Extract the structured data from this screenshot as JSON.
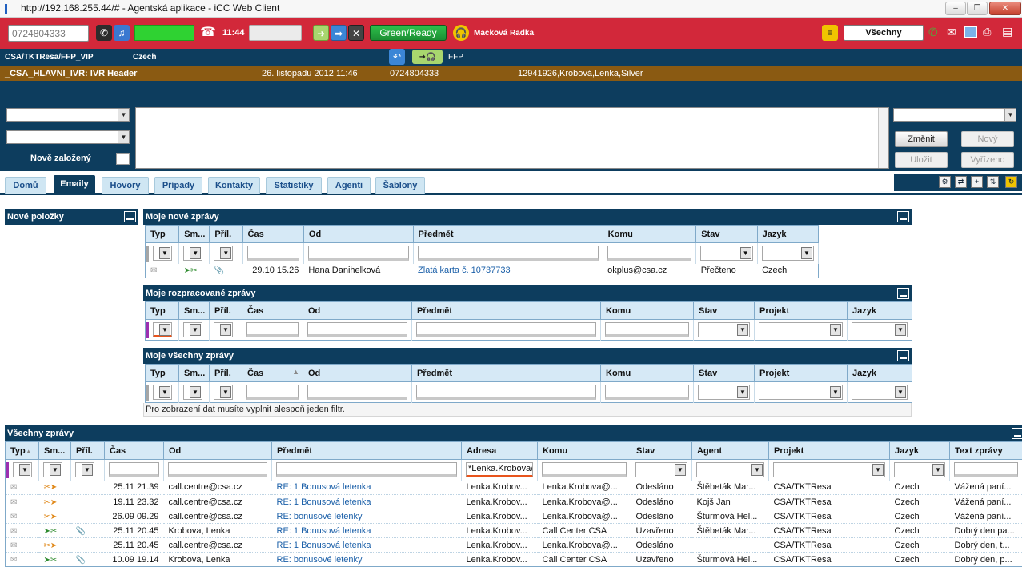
{
  "window": {
    "title": "http://192.168.255.44/# - Agentská aplikace - iCC Web Client"
  },
  "toolbar": {
    "phone_number": "0724804333",
    "call_time": "11:44",
    "status_label": "Green/Ready",
    "agent_name": "Macková Radka",
    "queue_select": "Všechny"
  },
  "info": {
    "campaign": "CSA/TKTResa/FFP_VIP",
    "language": "Czech",
    "ffp": "FFP"
  },
  "call": {
    "ivr": "_CSA_HLAVNI_IVR: IVR Header",
    "datetime": "26. listopadu 2012 11:46",
    "number": "0724804333",
    "customer": "12941926,Krobová,Lenka,Silver"
  },
  "form": {
    "new_created_label": "Nově založený",
    "buttons": {
      "change": "Změnit",
      "new": "Nový",
      "save": "Uložit",
      "done": "Vyřízeno"
    }
  },
  "tabs": [
    "Domů",
    "Emaily",
    "Hovory",
    "Případy",
    "Kontakty",
    "Statistiky",
    "Agenti",
    "Šablony"
  ],
  "panels": {
    "new_items": "Nové položky",
    "my_new": "Moje nové zprávy",
    "my_wip": "Moje rozpracované zprávy",
    "my_all": "Moje všechny zprávy",
    "all": "Všechny zprávy"
  },
  "columns": {
    "typ": "Typ",
    "sm": "Sm...",
    "pril": "Příl.",
    "cas": "Čas",
    "od": "Od",
    "predmet": "Předmět",
    "komu": "Komu",
    "stav": "Stav",
    "jazyk": "Jazyk",
    "projekt": "Projekt",
    "adresa": "Adresa",
    "agent": "Agent",
    "text": "Text zprávy"
  },
  "my_new_rows": [
    {
      "cas": "29.10 15.26",
      "od": "Hana Danihelková",
      "predmet": "Zlatá karta č. 10737733",
      "komu": "okplus@csa.cz",
      "stav": "Přečteno",
      "jazyk": "Czech"
    }
  ],
  "filter_note": "Pro zobrazení dat musíte vyplnit alespoň jeden filtr.",
  "address_filter": "*Lenka.Krobova@",
  "all_rows": [
    {
      "cas": "25.11 21.39",
      "od": "call.centre@csa.cz",
      "predmet": "RE: 1 Bonusová letenka",
      "adresa": "Lenka.Krobov...",
      "komu": "Lenka.Krobova@...",
      "stav": "Odesláno",
      "agent": "Štěbeták Mar...",
      "projekt": "CSA/TKTResa",
      "jazyk": "Czech",
      "text": "Vážená paní..."
    },
    {
      "cas": "19.11 23.32",
      "od": "call.centre@csa.cz",
      "predmet": "RE: 1 Bonusová letenka",
      "adresa": "Lenka.Krobov...",
      "komu": "Lenka.Krobova@...",
      "stav": "Odesláno",
      "agent": "Kojš Jan",
      "projekt": "CSA/TKTResa",
      "jazyk": "Czech",
      "text": "Vážená paní..."
    },
    {
      "cas": "26.09 09.29",
      "od": "call.centre@csa.cz",
      "predmet": "RE: bonusové letenky",
      "adresa": "Lenka.Krobov...",
      "komu": "Lenka.Krobova@...",
      "stav": "Odesláno",
      "agent": "Šturmová Hel...",
      "projekt": "CSA/TKTResa",
      "jazyk": "Czech",
      "text": "Vážená paní..."
    },
    {
      "cas": "25.11 20.45",
      "od": "Krobova, Lenka",
      "predmet": "RE: 1 Bonusová letenka",
      "adresa": "Lenka.Krobov...",
      "komu": "Call Center CSA",
      "stav": "Uzavřeno",
      "agent": "Štěbeták Mar...",
      "projekt": "CSA/TKTResa",
      "jazyk": "Czech",
      "text": "Dobrý den pa..."
    },
    {
      "cas": "25.11 20.45",
      "od": "call.centre@csa.cz",
      "predmet": "RE: 1 Bonusová letenka",
      "adresa": "Lenka.Krobov...",
      "komu": "Lenka.Krobova@...",
      "stav": "Odesláno",
      "agent": "",
      "projekt": "CSA/TKTResa",
      "jazyk": "Czech",
      "text": "Dobrý den, t..."
    },
    {
      "cas": "10.09 19.14",
      "od": "Krobova, Lenka",
      "predmet": "RE: bonusové letenky",
      "adresa": "Lenka.Krobov...",
      "komu": "Call Center CSA",
      "stav": "Uzavřeno",
      "agent": "Šturmová Hel...",
      "projekt": "CSA/TKTResa",
      "jazyk": "Czech",
      "text": "Dobrý den, p..."
    }
  ]
}
